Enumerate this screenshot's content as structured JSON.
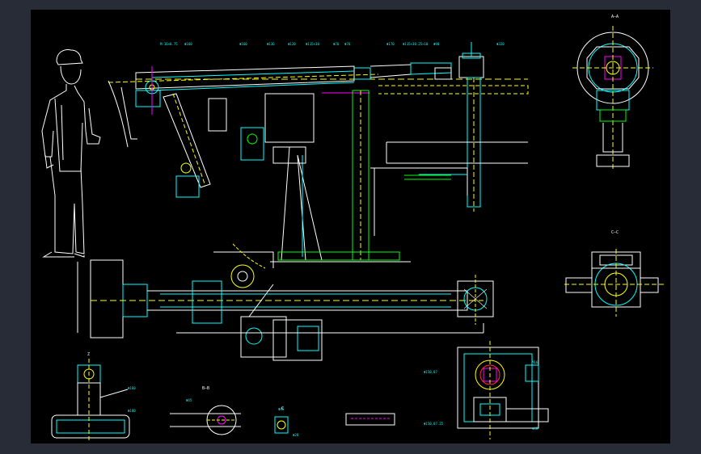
{
  "colors": {
    "window_bg": "#272c36",
    "sheet_bg": "#000000",
    "white": "#ffffff",
    "cyan": "#00ffff",
    "green": "#00ff00",
    "yellow": "#ffff00",
    "magenta": "#ff00ff",
    "red": "#ff3030"
  },
  "labels": {
    "top_left": [
      "M-16×0.75",
      "Φ160",
      "Φ160",
      "Φ136",
      "Φ120",
      "Φ115×30",
      "Φ76",
      "Φ76"
    ],
    "top_right": [
      "Φ170",
      "Φ115×30.25×10",
      "Φ90",
      "Φ320"
    ],
    "section_aa": "A—A",
    "section_bb": "B—B",
    "section_cc": "C—C",
    "section_z": "Z",
    "view_c": "C",
    "dim_small": [
      "Φ45",
      "Φ45",
      "Φ160",
      "Φ180",
      "Φ28"
    ],
    "bottom_right": [
      "Φ150.07",
      "Φ150.07.25",
      "M16",
      "Φ48"
    ]
  },
  "icons": [
    "operator-figure",
    "crane-arm-assembly",
    "gear-box-section",
    "flange-section"
  ]
}
